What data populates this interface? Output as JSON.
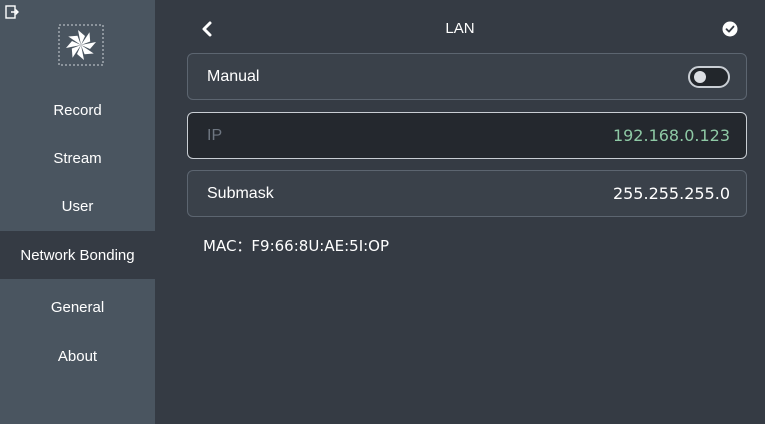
{
  "sidebar": {
    "exit_icon": "exit-icon",
    "logo_icon": "pinwheel-logo",
    "items": [
      {
        "label": "Record"
      },
      {
        "label": "Stream"
      },
      {
        "label": "User"
      },
      {
        "label": "Network Bonding",
        "active": true
      },
      {
        "label": "General"
      },
      {
        "label": "About"
      }
    ]
  },
  "header": {
    "title": "LAN",
    "back_icon": "chevron-left-icon",
    "confirm_icon": "check-circle-icon"
  },
  "form": {
    "manual": {
      "label": "Manual",
      "toggle_on": false
    },
    "ip": {
      "label": "IP",
      "value": "192.168.0.123"
    },
    "submask": {
      "label": "Submask",
      "value": "255.255.255.0"
    },
    "mac": "MAC：F9:66:8U:AE:5I:OP"
  },
  "colors": {
    "sidebar_bg": "#4a5560",
    "content_bg": "#353b44",
    "highlight_value": "#8ec9a5"
  }
}
